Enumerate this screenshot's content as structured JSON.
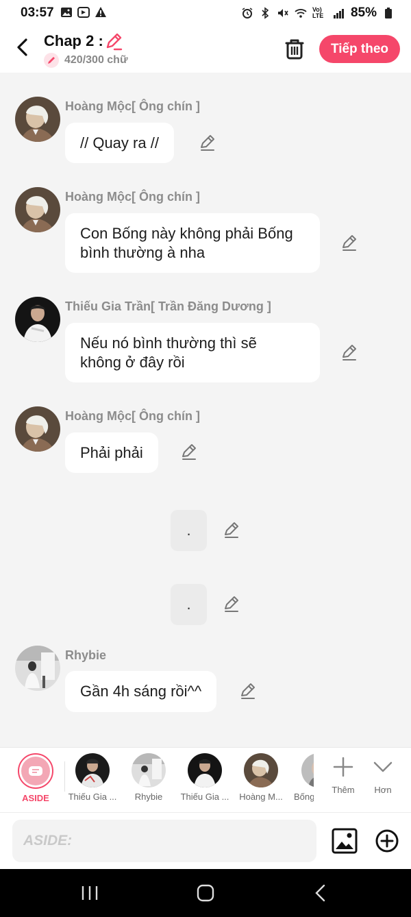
{
  "status_bar": {
    "time": "03:57",
    "battery": "85%",
    "network": "Vo) LTE"
  },
  "header": {
    "title": "Chap 2 :",
    "char_count": "420/300 chữ",
    "next_label": "Tiếp theo"
  },
  "messages": [
    {
      "speaker": "Hoàng Mộc[ Ông chín ]",
      "text": "// Quay ra //"
    },
    {
      "speaker": "Hoàng Mộc[ Ông chín ]",
      "line1": "Con Bống này không phải Bống",
      "line2": "bình thường à nha"
    },
    {
      "speaker": "Thiếu Gia Trần[ Trần Đăng Dương ]",
      "line1": "Nếu nó bình thường thì sẽ",
      "line2": "không ở đây rồi"
    },
    {
      "speaker": "Hoàng Mộc[ Ông chín ]",
      "text": "Phải phải"
    },
    {
      "speaker": "Rhybie",
      "text": "Gần 4h sáng rồi^^"
    }
  ],
  "narrations": [
    {
      "text": "."
    },
    {
      "text": "."
    }
  ],
  "characters": [
    {
      "label": "ASIDE"
    },
    {
      "label": "Thiếu Gia ..."
    },
    {
      "label": "Rhybie"
    },
    {
      "label": "Thiếu Gia ..."
    },
    {
      "label": "Hoàng M..."
    },
    {
      "label": "Bống"
    }
  ],
  "bar_buttons": {
    "add_label": "Thêm",
    "more_label": "Hơn"
  },
  "input": {
    "placeholder": "ASIDE:",
    "value": ""
  },
  "colors": {
    "accent": "#f5476a",
    "background": "#f4f4f4",
    "bubble": "#ffffff",
    "speaker": "#8c8c8c"
  }
}
